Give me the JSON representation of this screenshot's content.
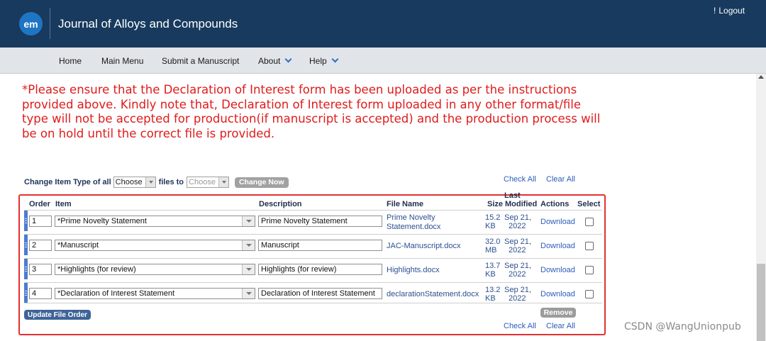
{
  "header": {
    "logo_text": "em",
    "journal_title": "Journal of Alloys and Compounds",
    "logout_label": "Logout",
    "logout_prefix": "!"
  },
  "nav": {
    "items": [
      {
        "label": "Home"
      },
      {
        "label": "Main Menu"
      },
      {
        "label": "Submit a Manuscript"
      },
      {
        "label": "About"
      },
      {
        "label": "Help"
      }
    ]
  },
  "notice": {
    "text": "*Please ensure that the Declaration of Interest form has been uploaded as per the instructions provided above. Kindly note that, Declaration of Interest form uploaded in any other format/file type will not be accepted for production(if manuscript is accepted) and the production process will be on hold until the correct file is provided.",
    "color": "#e01b1b"
  },
  "change_bar": {
    "label_prefix": "Change Item Type of all",
    "select_from": "Choose",
    "label_middle": "files to",
    "select_to": "Choose",
    "button_label": "Change Now"
  },
  "links": {
    "check_all": "Check All",
    "clear_all": "Clear All"
  },
  "table": {
    "headers": {
      "order": "Order",
      "item": "Item",
      "description": "Description",
      "file_name": "File Name",
      "size": "Size",
      "last_modified_1": "Last",
      "last_modified_2": "Modified",
      "actions": "Actions",
      "select": "Select"
    },
    "rows": [
      {
        "order": "1",
        "item": "*Prime Novelty Statement",
        "description": "Prime Novelty Statement",
        "file_name_1": "Prime Novelty",
        "file_name_2": "Statement.docx",
        "size_1": "15.2",
        "size_2": "KB",
        "modified_1": "Sep 21,",
        "modified_2": "2022",
        "action": "Download"
      },
      {
        "order": "2",
        "item": "*Manuscript",
        "description": "Manuscript",
        "file_name_1": "JAC-Manuscript.docx",
        "file_name_2": "",
        "size_1": "32.0",
        "size_2": "MB",
        "modified_1": "Sep 21,",
        "modified_2": "2022",
        "action": "Download"
      },
      {
        "order": "3",
        "item": "*Highlights (for review)",
        "description": "Highlights (for review)",
        "file_name_1": "Highlights.docx",
        "file_name_2": "",
        "size_1": "13.7",
        "size_2": "KB",
        "modified_1": "Sep 21,",
        "modified_2": "2022",
        "action": "Download"
      },
      {
        "order": "4",
        "item": "*Declaration of Interest Statement",
        "description": "Declaration of Interest Statement",
        "file_name_1": "declarationStatement.docx",
        "file_name_2": "",
        "size_1": "13.2",
        "size_2": "KB",
        "modified_1": "Sep 21,",
        "modified_2": "2022",
        "action": "Download"
      }
    ],
    "update_order_button": "Update File Order",
    "remove_button": "Remove"
  },
  "watermark": "CSDN @WangUnionpub",
  "colors": {
    "header_bg": "#173a5e",
    "nav_bg": "#e1e4e8",
    "accent_blue": "#2c6fc4",
    "frame_red": "#e53030"
  }
}
